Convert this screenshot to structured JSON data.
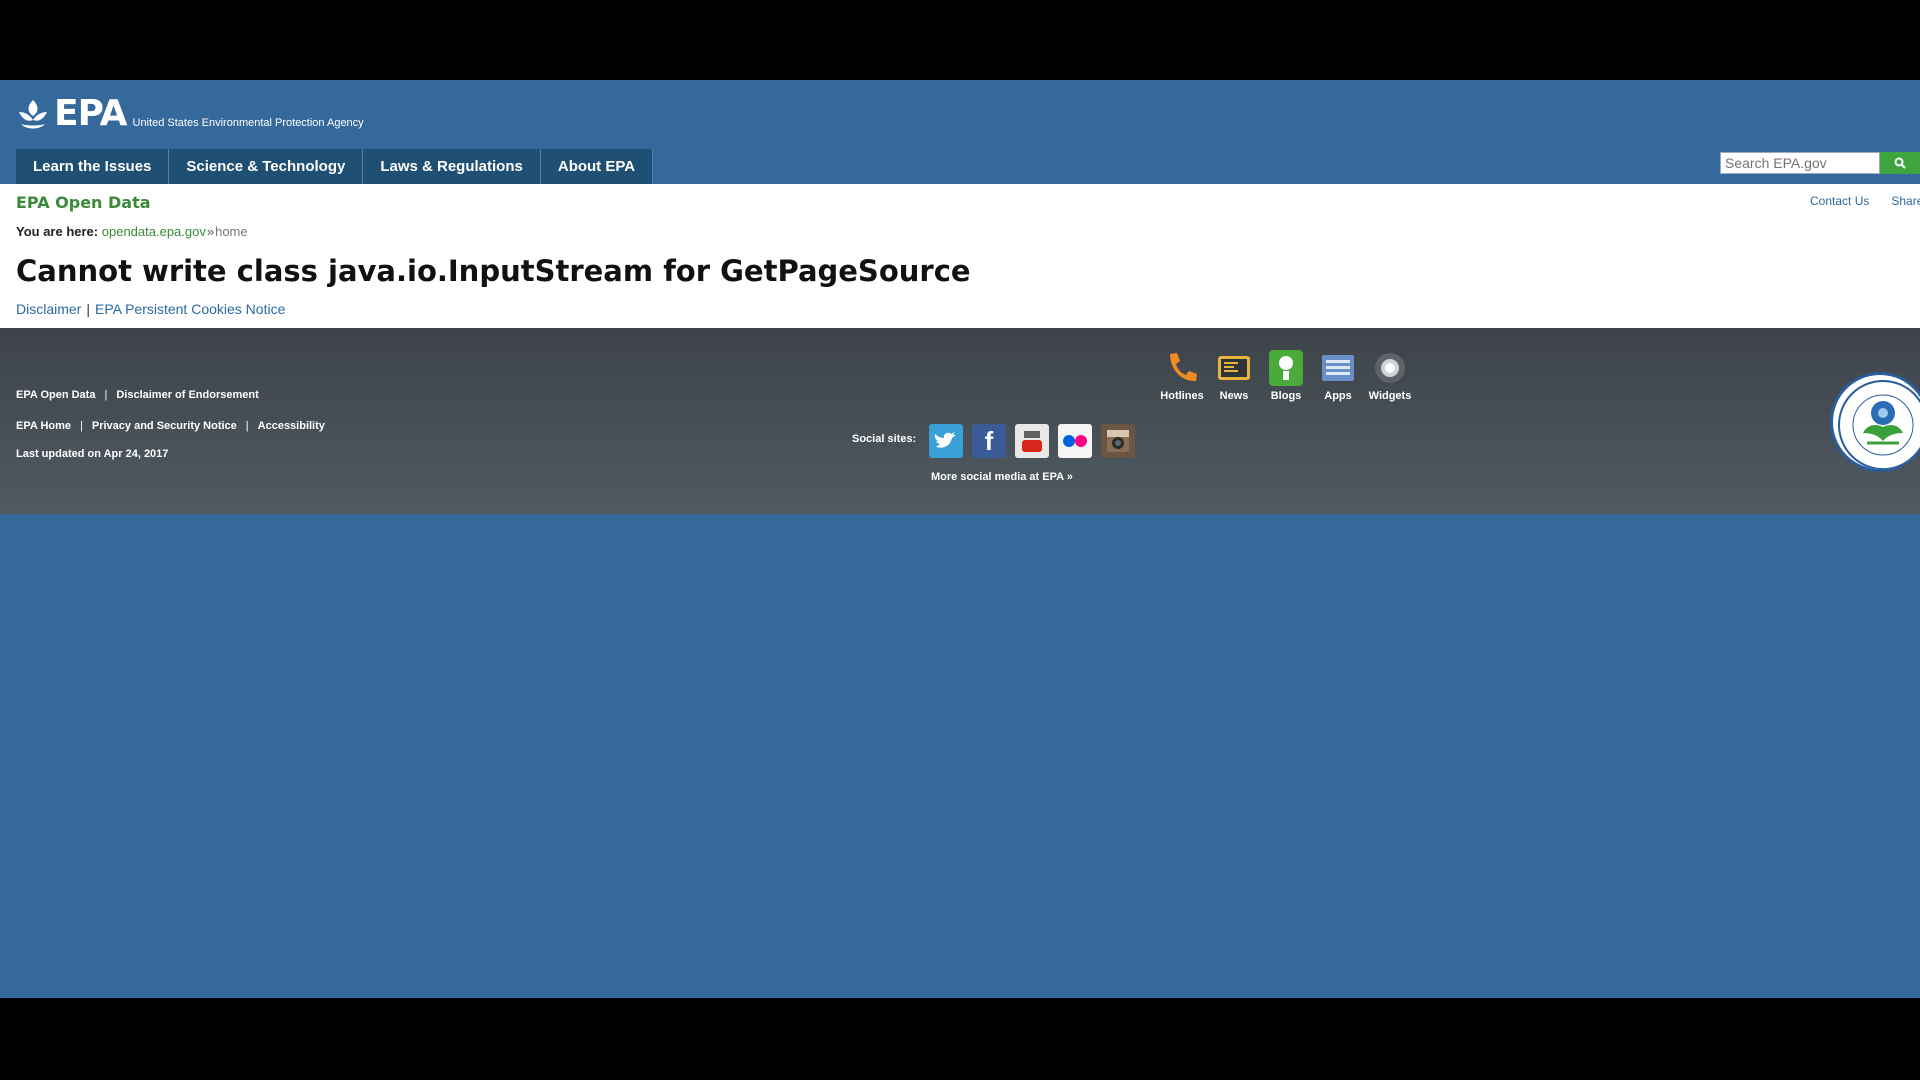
{
  "header": {
    "logo_text": "EPA",
    "logo_subtitle": "United States Environmental Protection Agency",
    "nav": [
      {
        "label": "Learn the Issues"
      },
      {
        "label": "Science & Technology"
      },
      {
        "label": "Laws & Regulations"
      },
      {
        "label": "About EPA"
      }
    ],
    "search_placeholder": "Search EPA.gov"
  },
  "content": {
    "site_name": "EPA Open Data",
    "top_links": [
      "Contact Us",
      "Share"
    ],
    "breadcrumb": {
      "label": "You are here:",
      "link": "opendata.epa.gov",
      "separator": "»",
      "current": "home"
    },
    "title": "Cannot write class java.io.InputStream for GetPageSource",
    "sub_links": [
      "Disclaimer",
      "EPA Persistent Cookies Notice"
    ]
  },
  "footer": {
    "row1": [
      "EPA Open Data",
      "Disclaimer of Endorsement"
    ],
    "row2": [
      "EPA Home",
      "Privacy and Security Notice",
      "Accessibility"
    ],
    "updated": "Last updated on Apr 24, 2017",
    "tools": [
      {
        "label": "Hotlines",
        "icon": "phone-icon"
      },
      {
        "label": "News",
        "icon": "news-icon"
      },
      {
        "label": "Blogs",
        "icon": "blogs-icon"
      },
      {
        "label": "Apps",
        "icon": "apps-icon"
      },
      {
        "label": "Widgets",
        "icon": "widgets-icon"
      }
    ],
    "social_label": "Social sites:",
    "social": [
      {
        "name": "twitter-icon",
        "color": "#3aa0d8"
      },
      {
        "name": "facebook-icon",
        "color": "#3b5b98"
      },
      {
        "name": "youtube-icon",
        "color": "#e8e8e8"
      },
      {
        "name": "flickr-icon",
        "color": "#f5f5f5"
      },
      {
        "name": "instagram-icon",
        "color": "#6b5545"
      }
    ],
    "more_social": "More social media at EPA »"
  },
  "colors": {
    "brand_blue": "#35689b",
    "nav_blue": "#1f4f73",
    "green": "#3a8a3a",
    "footer_gray": "#464e55"
  }
}
